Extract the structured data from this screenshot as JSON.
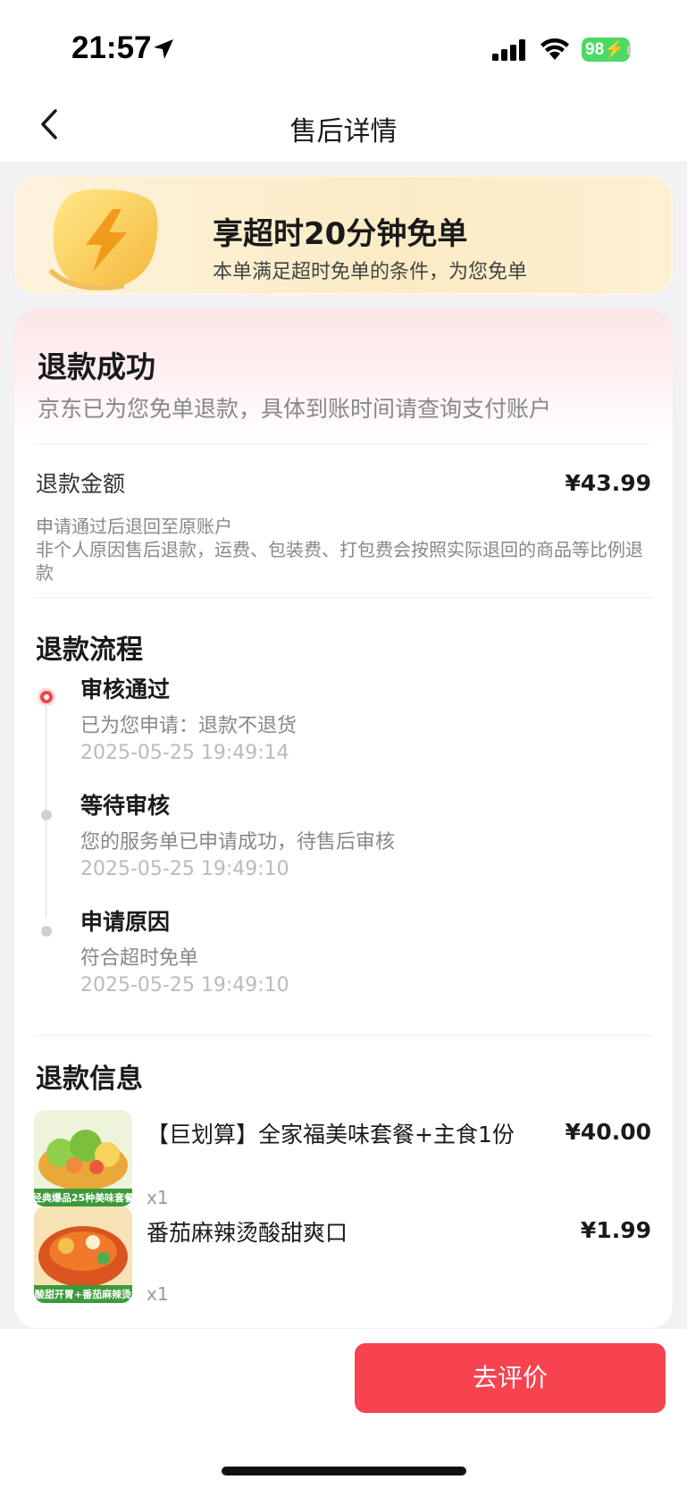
{
  "status_bar": {
    "time": "21:57",
    "battery": "98",
    "icons": [
      "location-arrow-icon",
      "signal-icon",
      "wifi-icon",
      "battery-icon"
    ]
  },
  "nav": {
    "title": "售后详情",
    "back_icon": "chevron-left-icon"
  },
  "banner": {
    "title": "享超时20分钟免单",
    "subtitle": "本单满足超时免单的条件，为您免单",
    "icon": "lightning-badge-icon"
  },
  "refund": {
    "status_title": "退款成功",
    "status_desc": "京东已为您免单退款，具体到账时间请查询支付账户",
    "amount_label": "退款金额",
    "amount_value": "¥43.99",
    "note_line1": "申请通过后退回至原账户",
    "note_line2": "非个人原因售后退款，运费、包装费、打包费会按照实际退回的商品等比例退款"
  },
  "process": {
    "title": "退款流程",
    "steps": [
      {
        "title": "审核通过",
        "desc": "已为您申请：退款不退货",
        "time": "2025-05-25 19:49:14"
      },
      {
        "title": "等待审核",
        "desc": "您的服务单已申请成功，待售后审核",
        "time": "2025-05-25 19:49:10"
      },
      {
        "title": "申请原因",
        "desc": "符合超时免单",
        "time": "2025-05-25 19:49:10"
      }
    ]
  },
  "refund_info": {
    "title": "退款信息",
    "items": [
      {
        "name": "【巨划算】全家福美味套餐+主食1份",
        "price": "¥40.00",
        "qty": "x1",
        "thumb_text": "经典爆品25种美味套餐"
      },
      {
        "name": "番茄麻辣烫酸甜爽口",
        "price": "¥1.99",
        "qty": "x1",
        "thumb_text": "酸甜开胃+番茄麻辣烫"
      }
    ]
  },
  "bottom": {
    "review_button": "去评价"
  },
  "colors": {
    "accent": "#f7424f",
    "banner_bg": "#fbebc5",
    "active_dot": "#f0464c"
  }
}
